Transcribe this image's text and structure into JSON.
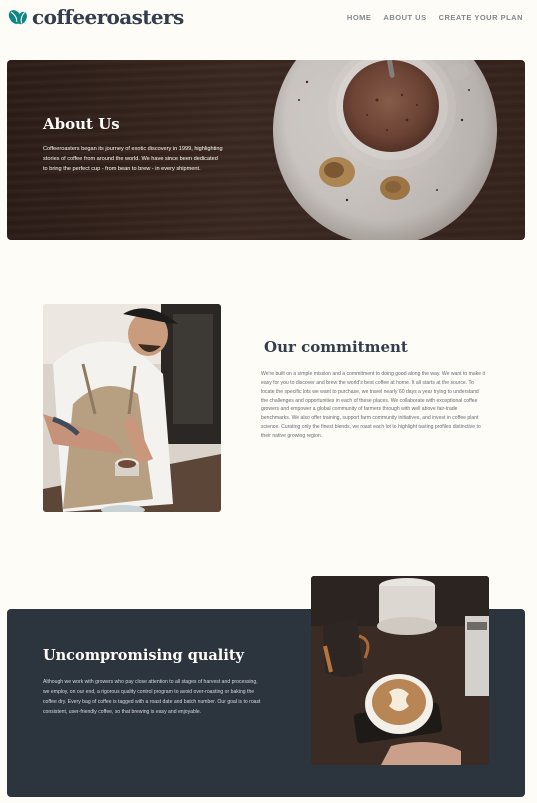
{
  "header": {
    "brand": "coffeeroasters",
    "logo_icon": "coffee-beans-icon",
    "nav": [
      "HOME",
      "ABOUT US",
      "CREATE YOUR PLAN"
    ]
  },
  "hero": {
    "title": "About Us",
    "text": "Coffeeroasters began its journey of exotic discovery in 1999, highlighting stories of coffee from around the world. We have since been dedicated to bring the perfect cup - from bean to brew - in every shipment."
  },
  "commitment": {
    "title": "Our commitment",
    "text": "We're built on a simple mission and a commitment to doing good along the way. We want to make it easy for you to discover and brew the world's best coffee at home. It all starts at the source. To locate the specific lots we want to purchase, we travel nearly 60 days a year trying to understand the challenges and opportunities in each of these places. We collaborate with exceptional coffee growers and empower a global community of farmers through with well above fair-trade benchmarks. We also offer training, support farm community initiatives, and invest in coffee plant science. Curating only the finest blends, we roast each lot to highlight tasting profiles distinctive to their native growing region."
  },
  "quality": {
    "title": "Uncompromising quality",
    "text": "Although we work with growers who pay close attention to all stages of harvest and processing, we employ, on our end, a rigorous quality control program to avoid over-roasting or baking the coffee dry. Every bag of coffee is tagged with a roast date and batch number. Our goal is to roast consistent, user-friendly coffee, so that brewing is easy and enjoyable."
  },
  "colors": {
    "background": "#fdfcf7",
    "dark_panel": "#2c343e",
    "heading": "#333d4b",
    "accent": "#0e8784"
  }
}
